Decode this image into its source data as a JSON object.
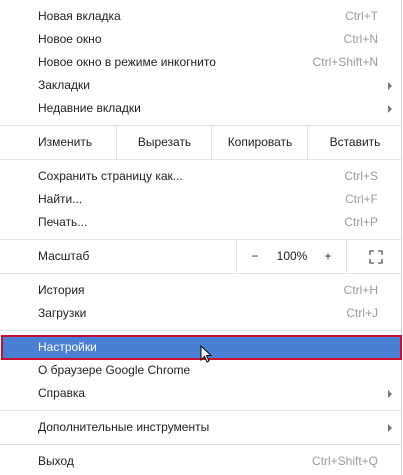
{
  "group1": [
    {
      "label": "Новая вкладка",
      "shortcut": "Ctrl+T"
    },
    {
      "label": "Новое окно",
      "shortcut": "Ctrl+N"
    },
    {
      "label": "Новое окно в режиме инкогнито",
      "shortcut": "Ctrl+Shift+N"
    },
    {
      "label": "Закладки",
      "shortcut": ""
    },
    {
      "label": "Недавние вкладки",
      "shortcut": ""
    }
  ],
  "edit": {
    "label": "Изменить",
    "cut": "Вырезать",
    "copy": "Копировать",
    "paste": "Вставить"
  },
  "group2": [
    {
      "label": "Сохранить страницу как...",
      "shortcut": "Ctrl+S"
    },
    {
      "label": "Найти...",
      "shortcut": "Ctrl+F"
    },
    {
      "label": "Печать...",
      "shortcut": "Ctrl+P"
    }
  ],
  "zoom": {
    "label": "Масштаб",
    "minus": "−",
    "level": "100%",
    "plus": "+"
  },
  "group3": [
    {
      "label": "История",
      "shortcut": "Ctrl+H"
    },
    {
      "label": "Загрузки",
      "shortcut": "Ctrl+J"
    }
  ],
  "group4": [
    {
      "label": "Настройки"
    },
    {
      "label": "О браузере Google Chrome"
    },
    {
      "label": "Справка"
    }
  ],
  "group5": [
    {
      "label": "Дополнительные инструменты"
    }
  ],
  "group6": [
    {
      "label": "Выход",
      "shortcut": "Ctrl+Shift+Q"
    }
  ],
  "colors": {
    "highlight": "#4a7fd6",
    "highlight_border": "#c8102e",
    "shortcut_text": "#9a9a9a"
  }
}
